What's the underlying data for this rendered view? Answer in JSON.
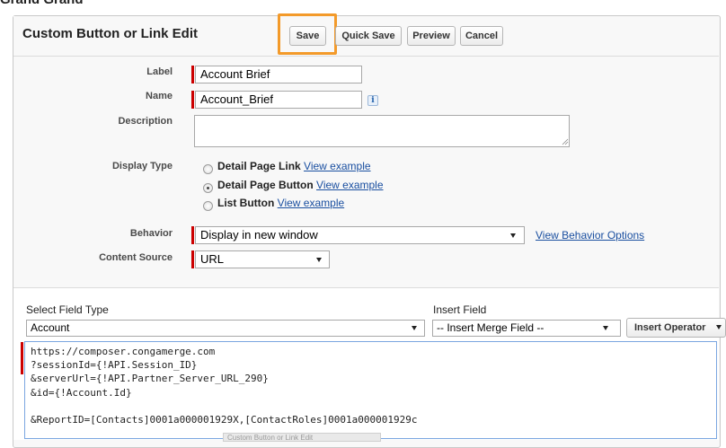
{
  "header": {
    "title": "Custom Button or Link Edit",
    "buttons": {
      "save": "Save",
      "quick_save": "Quick Save",
      "preview": "Preview",
      "cancel": "Cancel"
    },
    "highlight_color": "#f39a2a"
  },
  "form": {
    "label": {
      "caption": "Label",
      "value": "Account Brief"
    },
    "name": {
      "caption": "Name",
      "value": "Account_Brief",
      "info_glyph": "i"
    },
    "description": {
      "caption": "Description",
      "value": ""
    },
    "display_type": {
      "caption": "Display Type",
      "options": [
        {
          "label": "Detail Page Link",
          "link": "View example",
          "selected": false
        },
        {
          "label": "Detail Page Button",
          "link": "View example",
          "selected": true
        },
        {
          "label": "List Button",
          "link": "View example",
          "selected": false
        }
      ]
    },
    "behavior": {
      "caption": "Behavior",
      "value": "Display in new window",
      "options_link": "View Behavior Options"
    },
    "content_source": {
      "caption": "Content Source",
      "value": "URL"
    }
  },
  "editor": {
    "select_field_type": {
      "caption": "Select Field Type",
      "value": "Account"
    },
    "insert_field": {
      "caption": "Insert Field",
      "value": "-- Insert Merge Field --"
    },
    "insert_operator": "Insert Operator",
    "code_lines": [
      "https://composer.congamerge.com",
      "?sessionId={!API.Session_ID}",
      "&serverUrl={!API.Partner_Server_URL_290}",
      "&id={!Account.Id}",
      "",
      "&ReportID=[Contacts]0001a000001929X,[ContactRoles]0001a000001929c"
    ],
    "tooltip_ghost": "Custom Button or Link Edit"
  },
  "colors": {
    "required_bar": "#cc0000",
    "link": "#1a4fa0",
    "code_border": "#7aa6e0"
  }
}
